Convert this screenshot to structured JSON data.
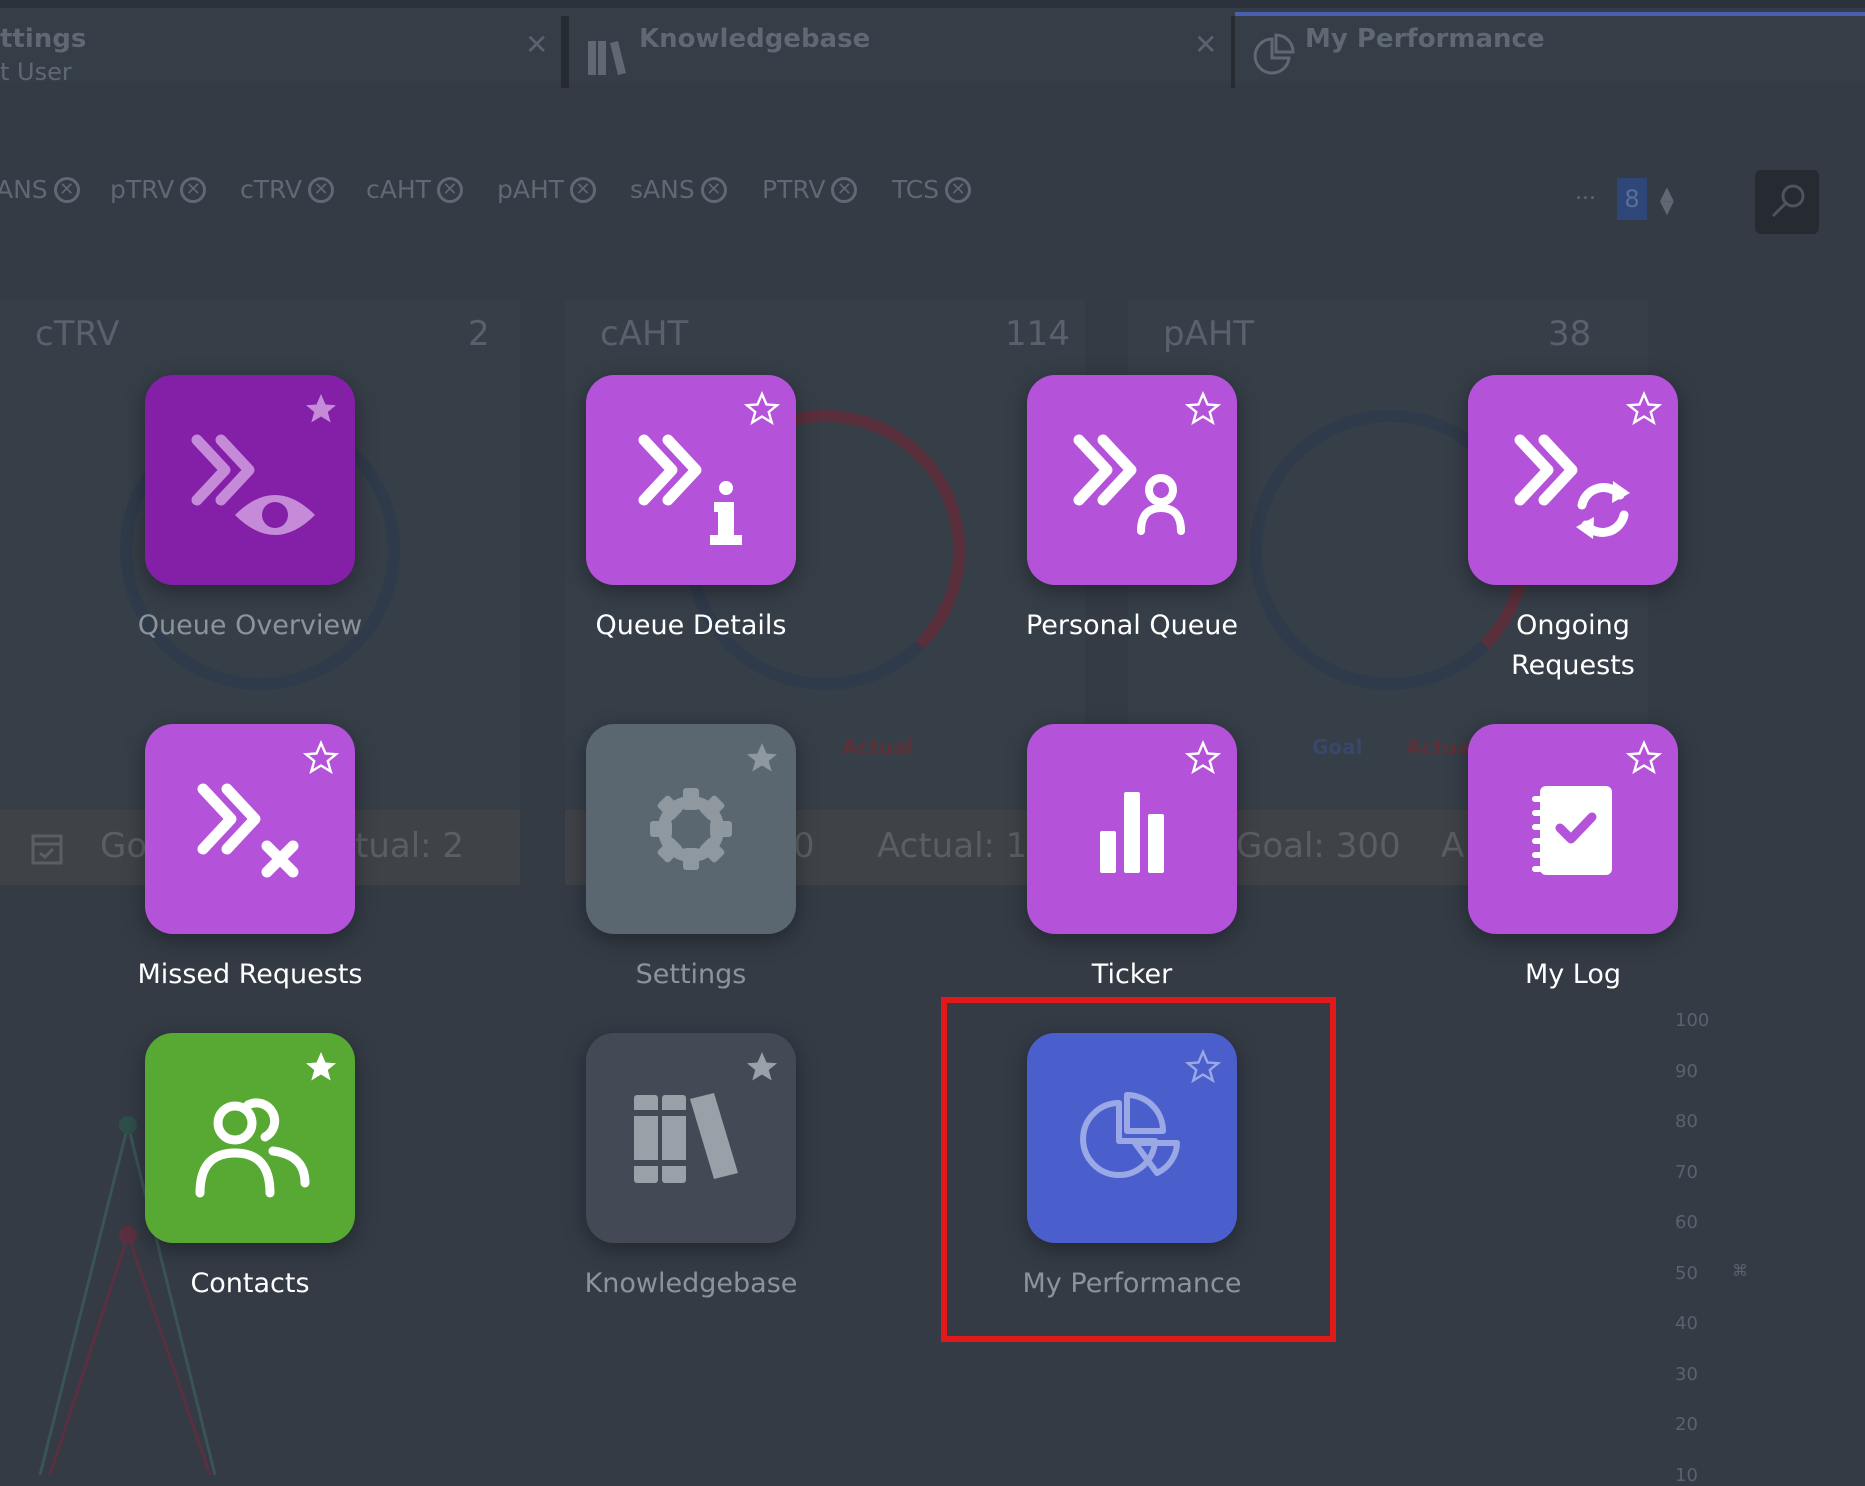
{
  "tabs": [
    {
      "title": "ttings",
      "subtitle": "t User"
    },
    {
      "title": "Knowledgebase"
    },
    {
      "title": "My Performance"
    }
  ],
  "filters": [
    "ANS",
    "pTRV",
    "cTRV",
    "cAHT",
    "pAHT",
    "sANS",
    "PTRV",
    "TCS"
  ],
  "pager": {
    "ellipsis": "...",
    "page": "8"
  },
  "cards": [
    {
      "title": "cTRV",
      "value": "2"
    },
    {
      "title": "cAHT",
      "value": "114"
    },
    {
      "title": "pAHT",
      "value": "38"
    }
  ],
  "gauge_labels": {
    "actual1": "Actual",
    "goal2": "Goal",
    "actual2": "Actua"
  },
  "goal_bars": {
    "b1": "Go",
    "b1b": "tual: 2",
    "b2": "0",
    "b2b": "Actual: 11",
    "b3": "Goal: 300",
    "b3b": "A"
  },
  "axis_ticks": [
    "100",
    "90",
    "80",
    "70",
    "60",
    "50",
    "40",
    "30",
    "20",
    "10"
  ],
  "apps": [
    {
      "label": "Queue Overview",
      "icon": "queue-overview-icon",
      "favorite": true,
      "dimmed": true
    },
    {
      "label": "Queue Details",
      "icon": "queue-details-icon",
      "favorite": false,
      "dimmed": false
    },
    {
      "label": "Personal Queue",
      "icon": "personal-queue-icon",
      "favorite": false,
      "dimmed": false
    },
    {
      "label": "Ongoing Requests",
      "icon": "ongoing-requests-icon",
      "favorite": false,
      "dimmed": false
    },
    {
      "label": "Missed Requests",
      "icon": "missed-requests-icon",
      "favorite": false,
      "dimmed": false
    },
    {
      "label": "Settings",
      "icon": "settings-icon",
      "favorite": true,
      "dimmed": true
    },
    {
      "label": "Ticker",
      "icon": "ticker-icon",
      "favorite": false,
      "dimmed": false
    },
    {
      "label": "My Log",
      "icon": "my-log-icon",
      "favorite": false,
      "dimmed": false
    },
    {
      "label": "Contacts",
      "icon": "contacts-icon",
      "favorite": true,
      "dimmed": false
    },
    {
      "label": "Knowledgebase",
      "icon": "knowledgebase-icon",
      "favorite": true,
      "dimmed": true
    },
    {
      "label": "My Performance",
      "icon": "my-performance-icon",
      "favorite": false,
      "dimmed": true,
      "highlighted": true
    }
  ],
  "colors": {
    "purple": "#b452d9",
    "purple_dark": "#8420a8",
    "gray_tile": "#5a6670",
    "dark_tile": "#434a56",
    "green": "#58a934",
    "blue": "#4a5fcc",
    "highlight": "#e2191b"
  }
}
